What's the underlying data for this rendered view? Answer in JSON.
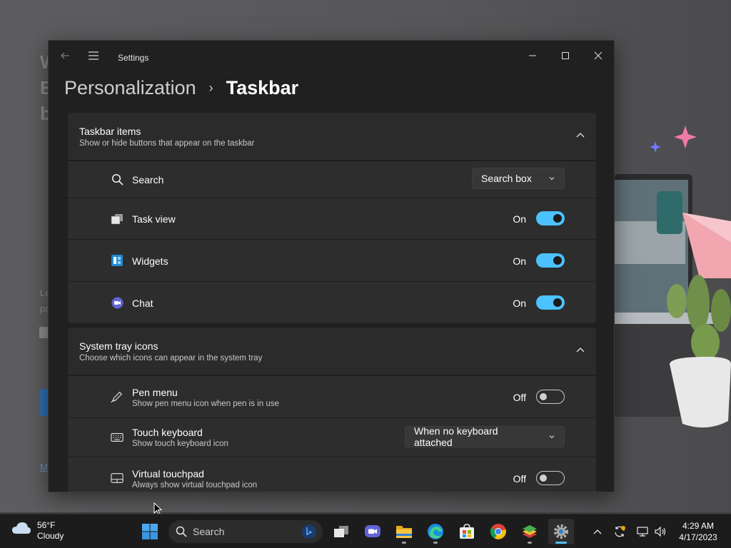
{
  "window": {
    "app_title": "Settings",
    "minimize_label": "Minimize",
    "maximize_label": "Maximize",
    "close_label": "Close"
  },
  "breadcrumb": {
    "parent": "Personalization",
    "separator": "›",
    "current": "Taskbar"
  },
  "taskbar_items_section": {
    "title": "Taskbar items",
    "subtitle": "Show or hide buttons that appear on the taskbar",
    "expanded": true,
    "rows": [
      {
        "icon": "search-icon",
        "label": "Search",
        "control": "dropdown",
        "value": "Search box"
      },
      {
        "icon": "task-view-icon",
        "label": "Task view",
        "control": "toggle",
        "state_label": "On",
        "on": true
      },
      {
        "icon": "widgets-icon",
        "label": "Widgets",
        "control": "toggle",
        "state_label": "On",
        "on": true
      },
      {
        "icon": "chat-icon",
        "label": "Chat",
        "control": "toggle",
        "state_label": "On",
        "on": true
      }
    ]
  },
  "system_tray_section": {
    "title": "System tray icons",
    "subtitle": "Choose which icons can appear in the system tray",
    "expanded": true,
    "rows": [
      {
        "icon": "pen-icon",
        "label": "Pen menu",
        "sublabel": "Show pen menu icon when pen is in use",
        "control": "toggle",
        "state_label": "Off",
        "on": false
      },
      {
        "icon": "keyboard-icon",
        "label": "Touch keyboard",
        "sublabel": "Show touch keyboard icon",
        "control": "dropdown",
        "value": "When no keyboard attached"
      },
      {
        "icon": "touchpad-icon",
        "label": "Virtual touchpad",
        "sublabel": "Always show virtual touchpad icon",
        "control": "toggle",
        "state_label": "Off",
        "on": false
      }
    ]
  },
  "taskbar": {
    "weather": {
      "temp": "56°F",
      "condition": "Cloudy"
    },
    "search_placeholder": "Search",
    "apps": [
      "start-icon",
      "task-view-icon",
      "chat-icon",
      "file-explorer-icon",
      "edge-icon",
      "store-icon",
      "chrome-icon",
      "bluestacks-icon",
      "settings-icon"
    ],
    "clock": {
      "time": "4:29 AM",
      "date": "4/17/2023"
    }
  },
  "background_app": {
    "heading_fragments": [
      "W",
      "E",
      "b"
    ],
    "text_fragments": [
      "Le",
      "pa",
      "M"
    ]
  },
  "colors": {
    "accent": "#4cc2ff",
    "window_bg": "#202020",
    "card_bg": "#2b2b2b"
  }
}
